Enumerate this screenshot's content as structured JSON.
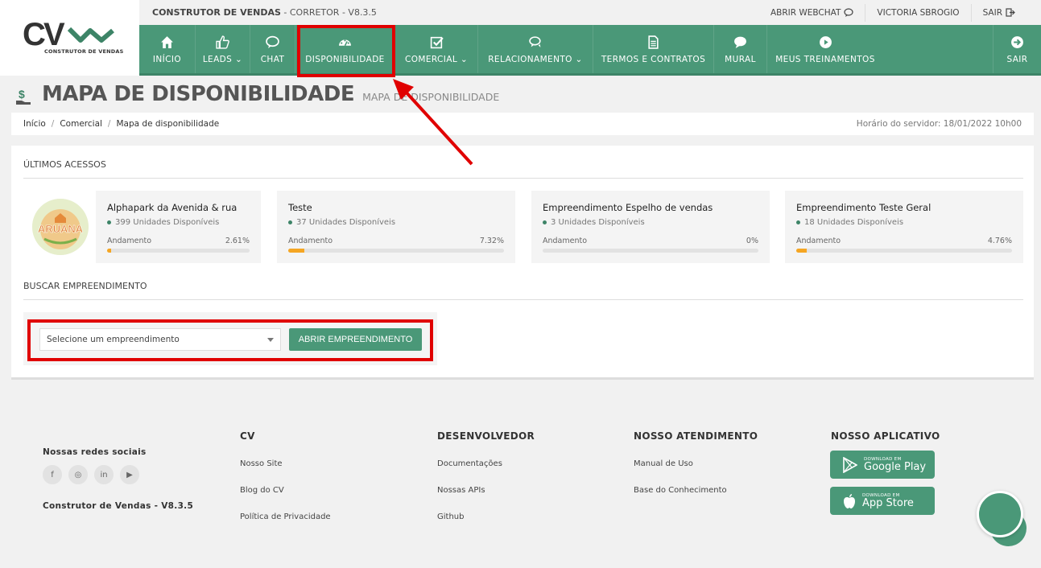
{
  "logo": {
    "text": "CV",
    "subtitle": "CONSTRUTOR DE VENDAS"
  },
  "system": {
    "name": "CONSTRUTOR DE VENDAS",
    "suffix": "- CORRETOR - V8.3.5"
  },
  "top_right": {
    "webchat": "ABRIR WEBCHAT",
    "user": "VICTORIA SBROGIO",
    "logout": "SAIR"
  },
  "nav": {
    "inicio": "INÍCIO",
    "leads": "LEADS",
    "chat": "CHAT",
    "disponibilidade": "DISPONIBILIDADE",
    "comercial": "COMERCIAL",
    "relacionamento": "RELACIONAMENTO",
    "termos": "TERMOS E CONTRATOS",
    "mural": "MURAL",
    "treinamentos": "MEUS TREINAMENTOS",
    "sair": "SAIR"
  },
  "page": {
    "title": "MAPA DE DISPONIBILIDADE",
    "subtitle": "MAPA DE DISPONIBILIDADE"
  },
  "breadcrumb": {
    "items": [
      "Início",
      "Comercial",
      "Mapa de disponibilidade"
    ],
    "server_time": "Horário do servidor: 18/01/2022 10h00"
  },
  "ultimos": {
    "label": "ÚLTIMOS ACESSOS",
    "avatar_text": "ARUANA",
    "cards": [
      {
        "name": "Alphapark da Avenida & rua",
        "units": "399 Unidades Disponíveis",
        "progress_label": "Andamento",
        "percent": "2.61%",
        "progress": 2.61
      },
      {
        "name": "Teste",
        "units": "37 Unidades Disponíveis",
        "progress_label": "Andamento",
        "percent": "7.32%",
        "progress": 7.32
      },
      {
        "name": "Empreendimento Espelho de vendas",
        "units": "3 Unidades Disponíveis",
        "progress_label": "Andamento",
        "percent": "0%",
        "progress": 0
      },
      {
        "name": "Empreendimento Teste Geral",
        "units": "18 Unidades Disponíveis",
        "progress_label": "Andamento",
        "percent": "4.76%",
        "progress": 4.76
      }
    ]
  },
  "busca": {
    "label": "BUSCAR EMPREENDIMENTO",
    "select_value": "Selecione um empreendimento",
    "button": "ABRIR EMPREENDIMENTO"
  },
  "footer": {
    "social_title": "Nossas redes sociais",
    "social": [
      "f",
      "◎",
      "in",
      "▶"
    ],
    "brand_version": "Construtor de Vendas - V8.3.5",
    "cv": {
      "title": "CV",
      "links": [
        "Nosso Site",
        "Blog do CV",
        "Política de Privacidade"
      ]
    },
    "dev": {
      "title": "DESENVOLVEDOR",
      "links": [
        "Documentações",
        "Nossas APIs",
        "Github"
      ]
    },
    "atendimento": {
      "title": "NOSSO ATENDIMENTO",
      "links": [
        "Manual de Uso",
        "Base do Conhecimento"
      ]
    },
    "app": {
      "title": "NOSSO APLICATIVO",
      "google_small": "DOWNLOAD EM",
      "google_big": "Google Play",
      "apple_small": "DOWNLOAD EM",
      "apple_big": "App Store"
    }
  },
  "colors": {
    "brand_green": "#4a9878",
    "highlight_red": "#e00000",
    "progress_orange": "#f5a623"
  }
}
